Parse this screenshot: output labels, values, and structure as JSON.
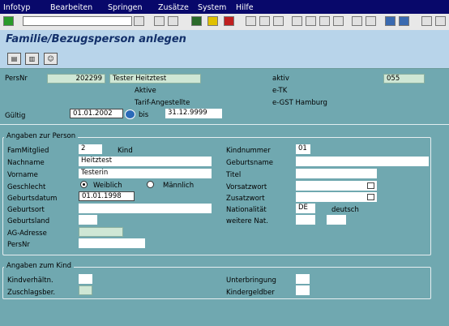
{
  "menu": [
    "Infotyp",
    "Bearbeiten",
    "Springen",
    "Zusätze",
    "System",
    "Hilfe"
  ],
  "title": "Familie/Bezugsperson anlegen",
  "header": {
    "persnr_label": "PersNr",
    "persnr_value": "202299",
    "name_value": "Tester Heitztest",
    "status_active": "aktiv",
    "status_code": "055",
    "aktive": "Aktive",
    "etk": "e-TK",
    "tarif": "Tarif-Angestellte",
    "gst": "e-GST Hamburg",
    "gueltig_label": "Gültig",
    "valid_from": "01.01.2002",
    "bis_label": "bis",
    "valid_to": "31.12.9999"
  },
  "person": {
    "group_title": "Angaben zur Person",
    "fammitglied_label": "FamMitglied",
    "fammitglied_value": "2",
    "kind_text": "Kind",
    "nachname_label": "Nachname",
    "nachname_value": "Heitztest",
    "vorname_label": "Vorname",
    "vorname_value": "Testerin",
    "geschlecht_label": "Geschlecht",
    "weiblich_label": "Weiblich",
    "maennlich_label": "Männlich",
    "selected_gender": "Weiblich",
    "geburtsdatum_label": "Geburtsdatum",
    "geburtsdatum_value": "01.01.1998",
    "geburtsort_label": "Geburtsort",
    "geburtsland_label": "Geburtsland",
    "ag_adresse_label": "AG-Adresse",
    "persnr_label": "PersNr",
    "kindnummer_label": "Kindnummer",
    "kindnummer_value": "01",
    "geburtsname_label": "Geburtsname",
    "titel_label": "Titel",
    "vorsatzwort_label": "Vorsatzwort",
    "zusatzwort_label": "Zusatzwort",
    "nationalitaet_label": "Nationalität",
    "nationalitaet_value": "DE",
    "nationalitaet_text": "deutsch",
    "weitere_nat_label": "weitere Nat."
  },
  "kind": {
    "group_title": "Angaben zum Kind",
    "kindverhaeltn_label": "Kindverhältn.",
    "zuschlagsber_label": "Zuschlagsber.",
    "unterbringung_label": "Unterbringung",
    "kindergeldber_label": "Kindergeldber"
  }
}
